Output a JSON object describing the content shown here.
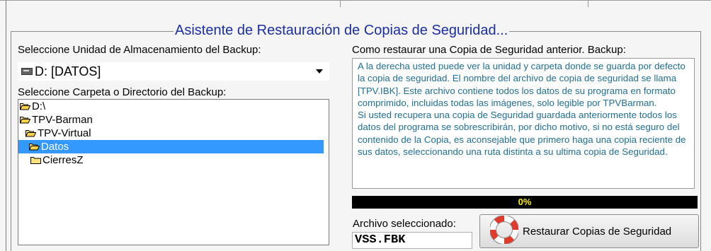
{
  "window": {
    "title": "Asistente de Restauración de Copias de Seguridad..."
  },
  "left": {
    "drive_label": "Seleccione Unidad de Almacenamiento del Backup:",
    "drive_value": "D: [DATOS]",
    "folder_label": "Seleccione Carpeta o Directorio del Backup:",
    "tree": [
      {
        "label": "D:\\",
        "level": 0,
        "selected": false
      },
      {
        "label": "TPV-Barman",
        "level": 0,
        "selected": false
      },
      {
        "label": "TPV-Virtual",
        "level": 1,
        "selected": false
      },
      {
        "label": "Datos",
        "level": 2,
        "selected": true
      },
      {
        "label": "CierresZ",
        "level": 3,
        "selected": false
      }
    ]
  },
  "right": {
    "help_title": "Como restaurar una Copia de Seguridad anterior. Backup:",
    "help_text": "A la derecha usted puede ver la unidad y carpeta donde se guarda por defecto la copia de seguridad. El nombre del archivo de copia de seguridad se llama [TPV.IBK]. Este archivo contiene todos los datos de su programa en formato comprimido, incluidas todas las imágenes, solo legible por TPVBarman.\nSi usted recupera una copia de Seguridad guardada anteriormente todos los datos del programa se sobrescribirán, por dicho motivo, si no está seguro del contenido de la Copia, es aconsejable que primero haga una copia reciente de sus datos, seleccionando una ruta distinta a su ultima copia de Seguridad.",
    "progress_percent": 0,
    "progress_label": "0%",
    "file_label": "Archivo seleccionado:",
    "file_value": "VSS.FBK",
    "restore_button": "Restaurar Copias de Seguridad"
  },
  "colors": {
    "title": "#1a2ea6",
    "help_text": "#1f6f9a",
    "progress_bg": "#000000",
    "progress_text": "#ffee00",
    "selection": "#3399ff"
  },
  "icons": {
    "drive": "drive-icon",
    "folder": "folder-icon",
    "folder_open": "folder-open-icon",
    "restore": "lifebuoy-icon"
  }
}
